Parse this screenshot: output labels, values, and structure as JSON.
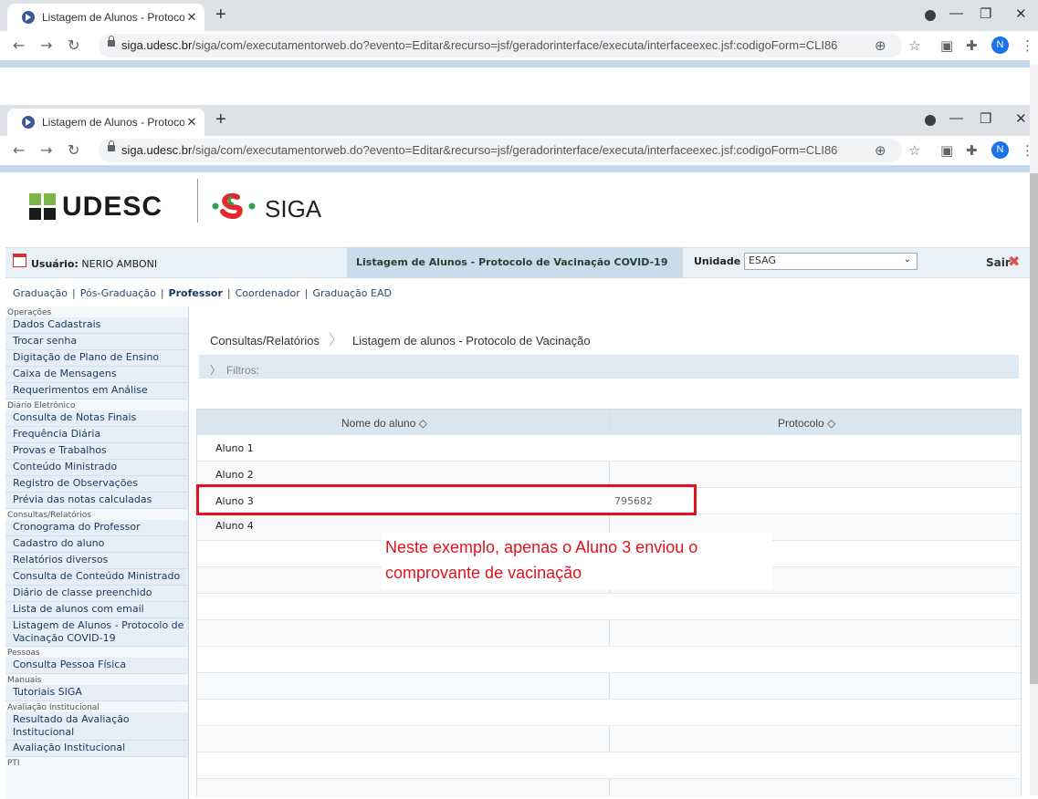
{
  "browser": {
    "tab_title": "Listagem de Alunos - Protocolo c",
    "url_host": "siga.udesc.br",
    "url_path": "/siga/com/executamentorweb.do?evento=Editar&recurso=jsf/geradorinterface/executa/interfaceexec.jsf:codigoForm=CLI86",
    "profile_initial": "N"
  },
  "header": {
    "logo": "UDESC",
    "system": "SIGA"
  },
  "userbar": {
    "user_label": "Usuário:",
    "user_name": "NERIO AMBONI",
    "page_title": "Listagem de Alunos - Protocolo de Vacinação COVID-19",
    "unit_label": "Unidade",
    "unit_value": "ESAG",
    "logout": "Sair"
  },
  "topmenu": [
    "Graduação",
    "Pós-Graduação",
    "Professor",
    "Coordenador",
    "Graduação EAD"
  ],
  "sidebar": {
    "g1": "Operações",
    "g1_items": [
      "Dados Cadastrais",
      "Trocar senha",
      "Digitação de Plano de Ensino",
      "Caixa de Mensagens",
      "Requerimentos em Análise"
    ],
    "g2": "Diário Eletrônico",
    "g2_items": [
      "Consulta de Notas Finais",
      "Frequência Diária",
      "Provas e Trabalhos",
      "Conteúdo Ministrado",
      "Registro de Observações",
      "Prévia das notas calculadas"
    ],
    "g3": "Consultas/Relatórios",
    "g3_items": [
      "Cronograma do Professor",
      "Cadastro do aluno",
      "Relatórios diversos",
      "Consulta de Conteúdo Ministrado",
      "Diário de classe preenchido",
      "Lista de alunos com email",
      "Listagem de Alunos - Protocolo de Vacinação COVID-19"
    ],
    "g4": "Pessoas",
    "g4_items": [
      "Consulta Pessoa Física"
    ],
    "g5": "Manuais",
    "g5_items": [
      "Tutoriais SIGA"
    ],
    "g6": "Avaliação Institucional",
    "g6_items": [
      "Resultado da Avaliação Institucional",
      "Avaliação Institucional"
    ],
    "g7": "PTI"
  },
  "main": {
    "crumb_parent": "Consultas/Relatórios",
    "crumb_current": "Listagem de alunos - Protocolo de Vacinação",
    "filters": "Filtros:",
    "col_name": "Nome do aluno",
    "col_protocol": "Protocolo",
    "rows": [
      {
        "name": "Aluno 1",
        "protocol": ""
      },
      {
        "name": "Aluno 2",
        "protocol": ""
      },
      {
        "name": "Aluno 3",
        "protocol": "795682"
      },
      {
        "name": "Aluno 4",
        "protocol": ""
      }
    ]
  },
  "annotation": {
    "line1": "Neste exemplo, apenas o Aluno 3 enviou o",
    "line2": "comprovante de vacinação"
  }
}
